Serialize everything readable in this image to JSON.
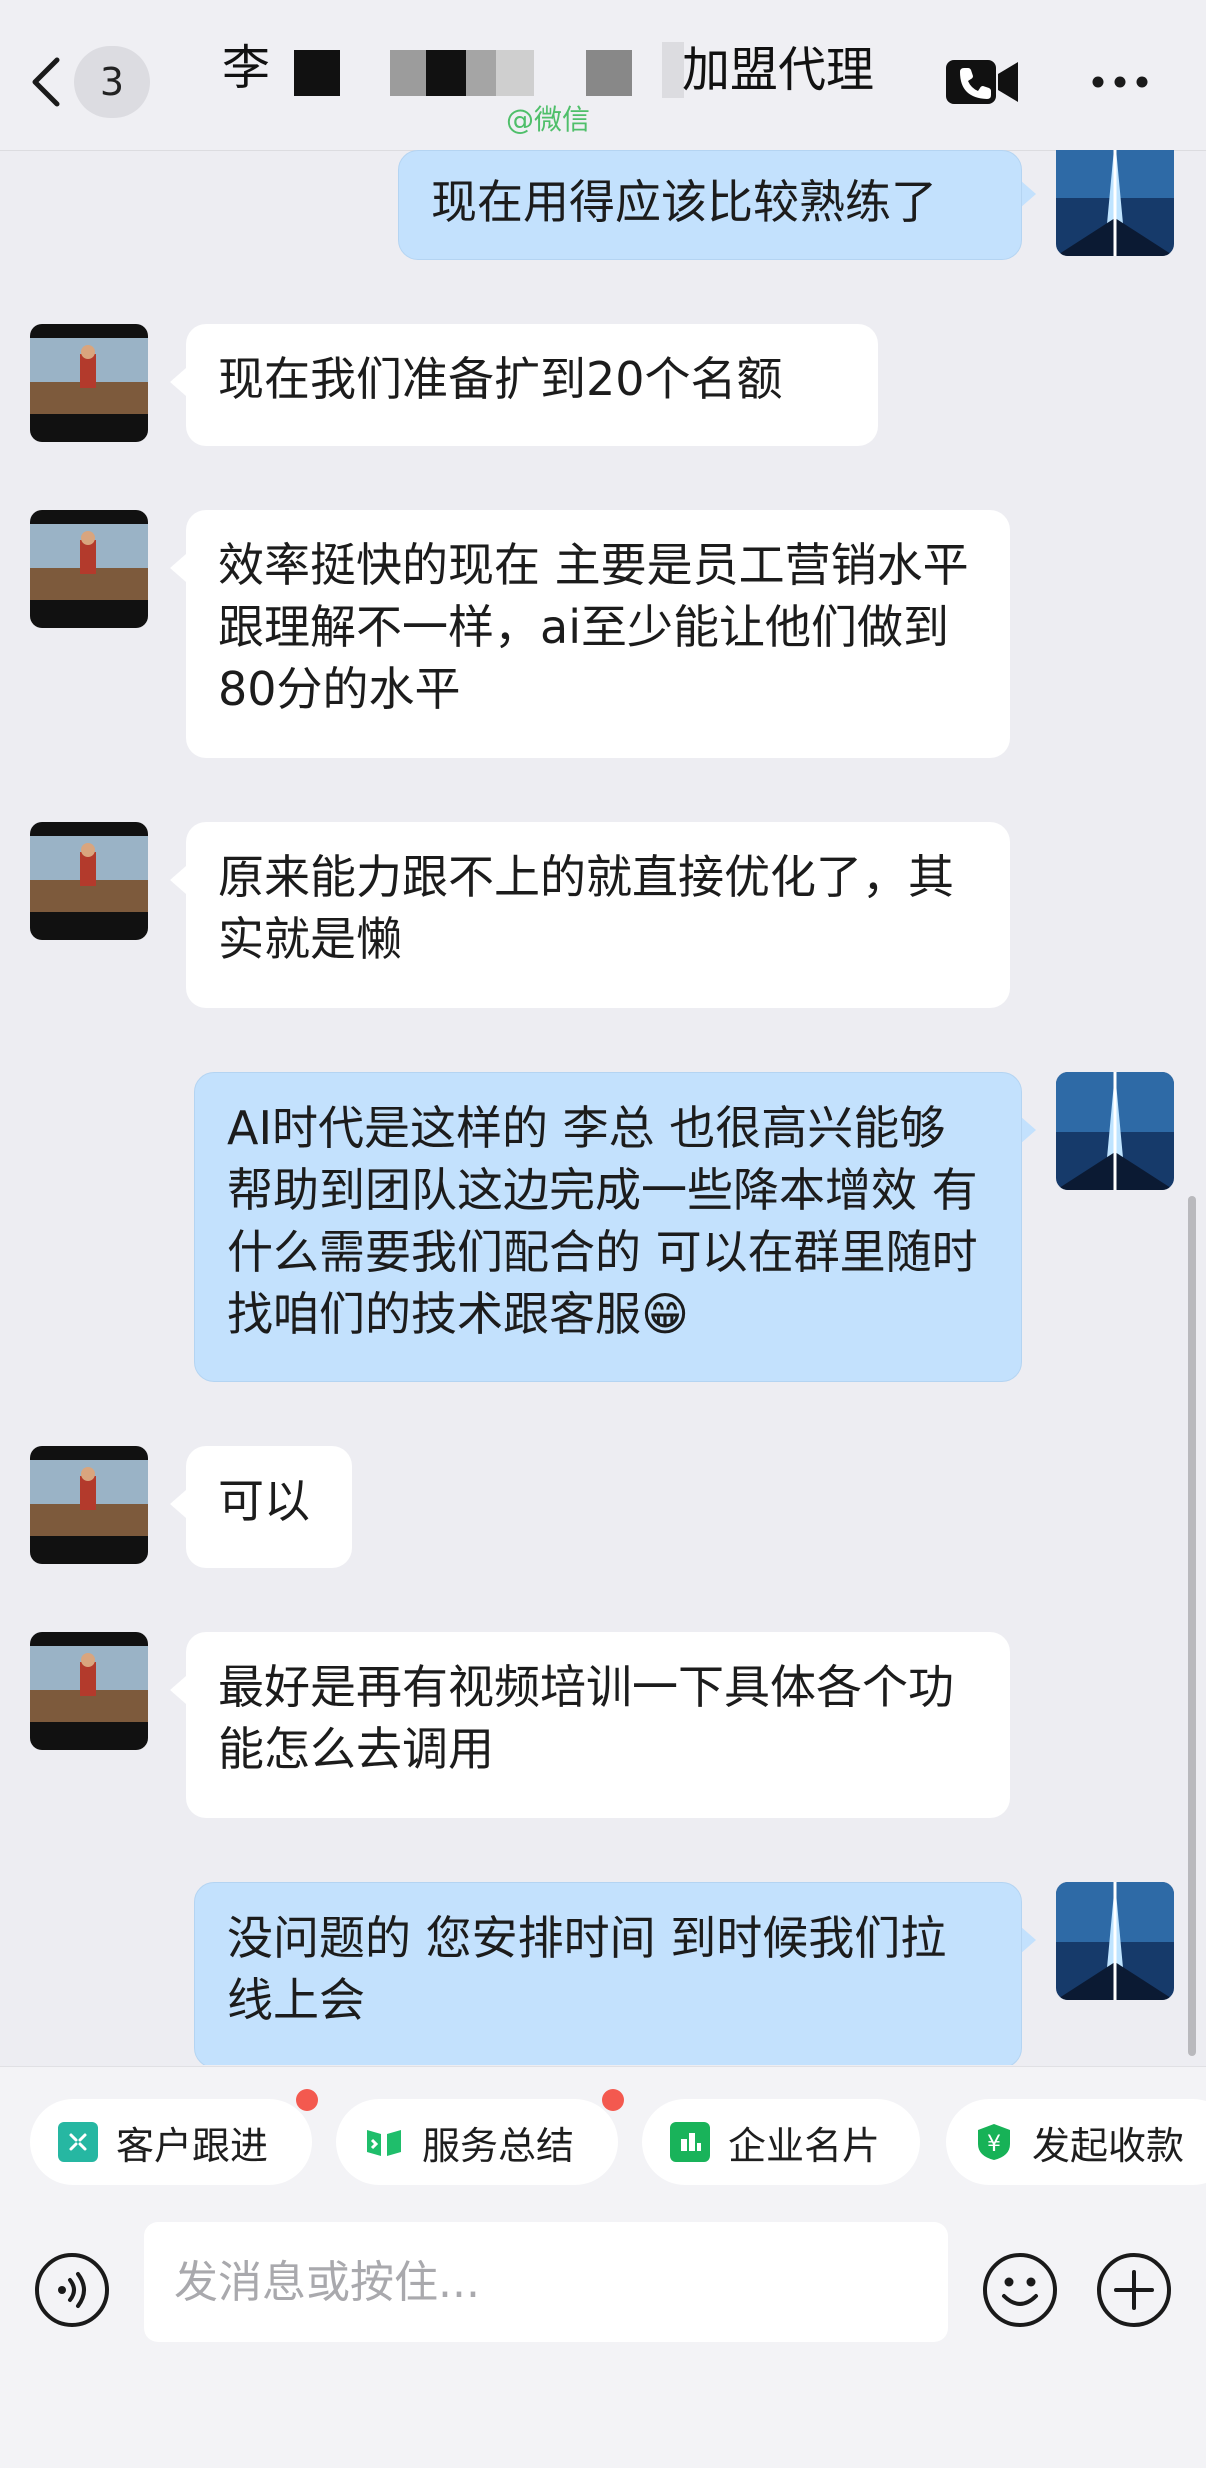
{
  "header": {
    "unread_count": "3",
    "title_left": "李",
    "title_right": "加盟代理",
    "source_tag": "@微信",
    "icons": {
      "back": "chevron-left-icon",
      "call": "video-call-icon",
      "more": "more-dots-icon"
    }
  },
  "messages": [
    {
      "side": "out",
      "text": "现在用得应该比较熟练了"
    },
    {
      "side": "in",
      "text": "现在我们准备扩到20个名额"
    },
    {
      "side": "in",
      "text": "效率挺快的现在 主要是员工营销水平跟理解不一样，ai至少能让他们做到80分的水平"
    },
    {
      "side": "in",
      "text": "原来能力跟不上的就直接优化了，其实就是懒"
    },
    {
      "side": "out",
      "text": "AI时代是这样的 李总 也很高兴能够帮助到团队这边完成一些降本增效 有什么需要我们配合的 可以在群里随时找咱们的技术跟客服😁"
    },
    {
      "side": "in",
      "text": "可以"
    },
    {
      "side": "in",
      "text": "最好是再有视频培训一下具体各个功能怎么去调用"
    },
    {
      "side": "out",
      "text": "没问题的 您安排时间 到时候我们拉线上会"
    }
  ],
  "quick_actions": [
    {
      "label": "客户跟进",
      "icon": "customer-followup-icon",
      "color": "#26b7a2",
      "has_dot": true
    },
    {
      "label": "服务总结",
      "icon": "service-summary-icon",
      "color": "#1fbe6b",
      "has_dot": true
    },
    {
      "label": "企业名片",
      "icon": "business-card-icon",
      "color": "#19b35a",
      "has_dot": false
    },
    {
      "label": "发起收款",
      "icon": "collect-payment-icon",
      "color": "#17b257",
      "has_dot": false
    }
  ],
  "input": {
    "placeholder": "发消息或按住..."
  },
  "colors": {
    "incoming_bubble": "#ffffff",
    "outgoing_bubble": "#c3e1fd",
    "badge_dot": "#f3594f"
  }
}
